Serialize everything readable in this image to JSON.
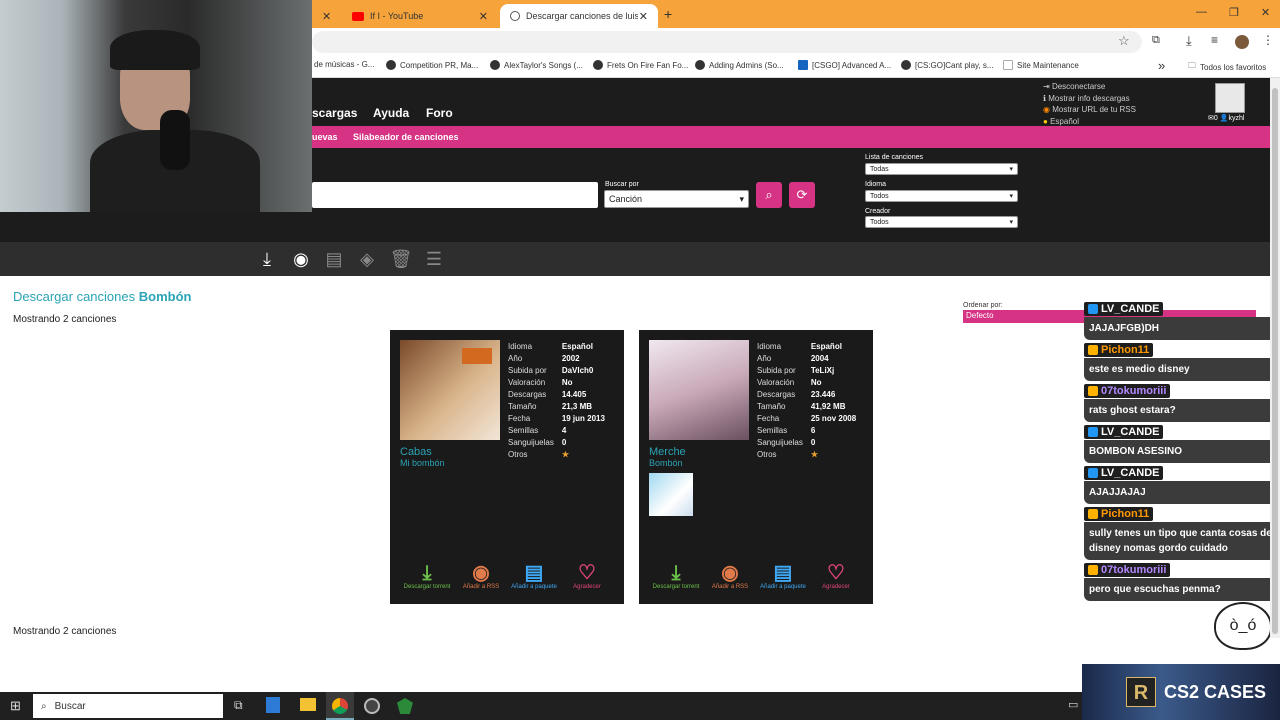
{
  "browser": {
    "tabs": [
      {
        "label": "If I - YouTube"
      },
      {
        "label": "Descargar canciones de luis fo"
      }
    ],
    "new_tab": "+",
    "window_controls": [
      "—",
      "❐",
      "✕"
    ],
    "bookmarks": [
      "de músicas - G...",
      "Competition PR, Ma...",
      "AlexTaylor's Songs (...",
      "Frets On Fire Fan Fo...",
      "Adding Admins (So...",
      "[CSGO] Advanced A...",
      "[CS:GO]Cant play, s...",
      "Site Maintenance"
    ],
    "bookmarks_more": "»",
    "all_bookmarks": "Todos los favoritos"
  },
  "site": {
    "nav": [
      "scargas",
      "Ayuda",
      "Foro"
    ],
    "subnav": [
      "uevas",
      "Silabeador de canciones"
    ],
    "user_menu": {
      "logout": "Desconectarse",
      "show_info": "Mostrar info descargas",
      "rss_url": "Mostrar URL de tu RSS",
      "language": "Español",
      "messages": "0",
      "username": "kyzhl"
    },
    "search": {
      "value": "",
      "by_label": "Buscar por",
      "by_value": "Canción"
    },
    "filters": [
      {
        "label": "Lista de canciones",
        "value": "Todas"
      },
      {
        "label": "Idioma",
        "value": "Todos"
      },
      {
        "label": "Creador",
        "value": "Todos"
      }
    ],
    "title_prefix": "Descargar canciones",
    "title_query": "Bombón",
    "showing": "Mostrando 2 canciones",
    "sort": {
      "label": "Ordenar por:",
      "value": "Defecto"
    }
  },
  "songs": [
    {
      "artist": "Cabas",
      "title": "Mi bombón",
      "meta": [
        [
          "Idioma",
          "Español"
        ],
        [
          "Año",
          "2002"
        ],
        [
          "Subida por",
          "DaVIch0"
        ],
        [
          "Valoración",
          "No"
        ],
        [
          "Descargas",
          "14.405"
        ],
        [
          "Tamaño",
          "21,3 MB"
        ],
        [
          "Fecha",
          "19 jun 2013"
        ],
        [
          "Semillas",
          "4"
        ],
        [
          "Sanguijuelas",
          "0"
        ],
        [
          "Otros",
          "★"
        ]
      ],
      "actions": [
        "Descargar torrent",
        "Añadir a RSS",
        "Añadir a paquete",
        "Agradecer"
      ]
    },
    {
      "artist": "Merche",
      "title": "Bombón",
      "meta": [
        [
          "Idioma",
          "Español"
        ],
        [
          "Año",
          "2004"
        ],
        [
          "Subida por",
          "TeLiXj"
        ],
        [
          "Valoración",
          "No"
        ],
        [
          "Descargas",
          "23.446"
        ],
        [
          "Tamaño",
          "41,92 MB"
        ],
        [
          "Fecha",
          "25 nov 2008"
        ],
        [
          "Semillas",
          "6"
        ],
        [
          "Sanguijuelas",
          "0"
        ],
        [
          "Otros",
          "★"
        ]
      ],
      "actions": [
        "Descargar torrent",
        "Añadir a RSS",
        "Añadir a paquete",
        "Agradecer"
      ]
    }
  ],
  "chat": [
    {
      "user": "LV_CANDE",
      "color": "#ffffff",
      "badge": "#2196f3",
      "text": "JAJAJFGB)DH"
    },
    {
      "user": "Pichon11",
      "color": "#ff9800",
      "badge": "#ffb300",
      "text": "este es medio disney"
    },
    {
      "user": "07tokumoriii",
      "color": "#b388ff",
      "badge": "#ffb300",
      "text": "rats ghost estara?"
    },
    {
      "user": "LV_CANDE",
      "color": "#ffffff",
      "badge": "#2196f3",
      "text": "BOMBON ASESINO"
    },
    {
      "user": "LV_CANDE",
      "color": "#ffffff",
      "badge": "#2196f3",
      "text": "AJAJJAJAJ"
    },
    {
      "user": "Pichon11",
      "color": "#ff9800",
      "badge": "#ffb300",
      "text": "sully tenes un tipo que canta cosas de disney nomas gordo cuidado"
    },
    {
      "user": "07tokumoriii",
      "color": "#b388ff",
      "badge": "#ffb300",
      "text": "pero que escuchas penma?"
    }
  ],
  "overlay": {
    "ad_text": "CS2 CASES",
    "ad_letter": "R"
  },
  "taskbar": {
    "search_placeholder": "Buscar"
  },
  "colors": {
    "accent": "#d63384",
    "link": "#2aa3b5",
    "dark": "#1c1c1c"
  }
}
